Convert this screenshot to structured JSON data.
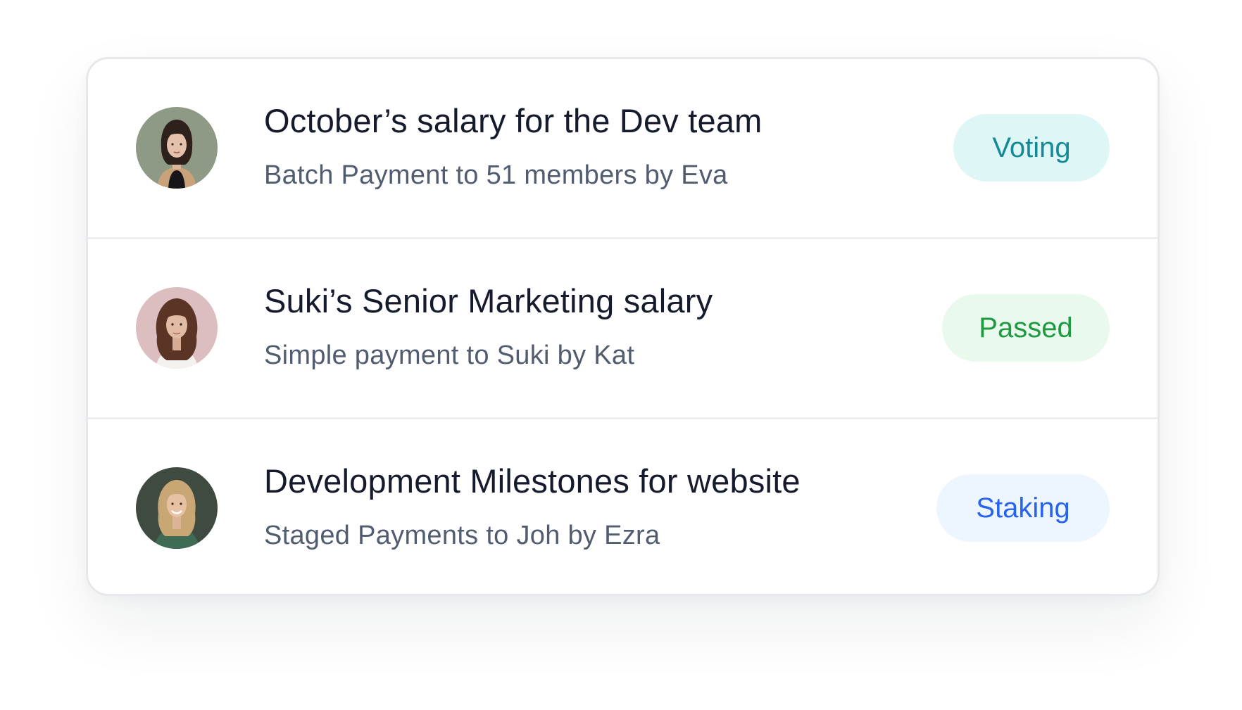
{
  "proposals": [
    {
      "title": "October’s salary for the Dev team",
      "subtitle": "Batch Payment to 51 members by Eva",
      "status": "Voting",
      "avatar": "woman-dark-bob-hair-avatar",
      "status_color": "#138a96",
      "status_bg": "#dff6f7"
    },
    {
      "title": "Suki’s Senior Marketing salary",
      "subtitle": "Simple payment to Suki by Kat",
      "status": "Passed",
      "avatar": "woman-long-wavy-hair-avatar",
      "status_color": "#1e9a40",
      "status_bg": "#e9f9ee"
    },
    {
      "title": "Development Milestones for website",
      "subtitle": "Staged Payments to Joh by Ezra",
      "status": "Staking",
      "avatar": "woman-blonde-hair-avatar",
      "status_color": "#2863eb",
      "status_bg": "#edf5ff"
    }
  ]
}
